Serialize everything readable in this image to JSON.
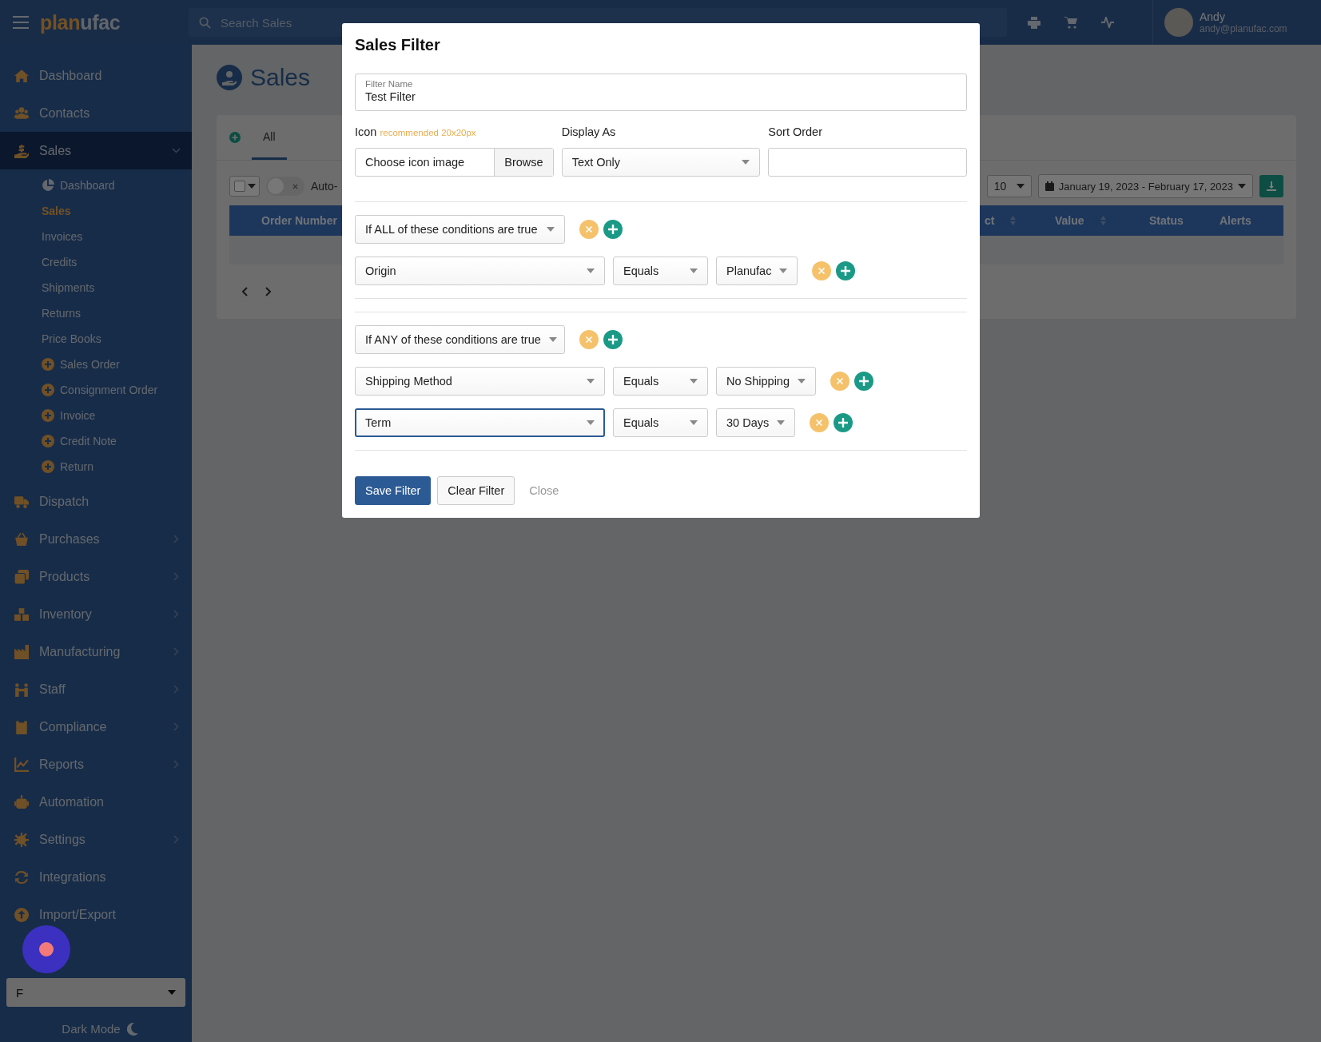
{
  "topbar": {
    "logo": {
      "accent": "plan",
      "rest": "ufac"
    },
    "search_placeholder": "Search Sales",
    "user": {
      "name": "Andy",
      "email": "andy@planufac.com"
    }
  },
  "sidebar": {
    "items": [
      {
        "label": "Dashboard",
        "selected": false
      },
      {
        "label": "Contacts",
        "selected": false
      },
      {
        "label": "Sales",
        "selected": true,
        "expanded": true,
        "children": [
          {
            "label": "Dashboard",
            "kind": "dashboard",
            "selected": false
          },
          {
            "label": "Sales",
            "kind": "link",
            "selected": true
          },
          {
            "label": "Invoices",
            "kind": "link",
            "selected": false
          },
          {
            "label": "Credits",
            "kind": "link",
            "selected": false
          },
          {
            "label": "Shipments",
            "kind": "link",
            "selected": false
          },
          {
            "label": "Returns",
            "kind": "link",
            "selected": false
          },
          {
            "label": "Price Books",
            "kind": "link",
            "selected": false
          },
          {
            "label": "Sales Order",
            "kind": "create",
            "selected": false
          },
          {
            "label": "Consignment Order",
            "kind": "create",
            "selected": false
          },
          {
            "label": "Invoice",
            "kind": "create",
            "selected": false
          },
          {
            "label": "Credit Note",
            "kind": "create",
            "selected": false
          },
          {
            "label": "Return",
            "kind": "create",
            "selected": false
          }
        ]
      },
      {
        "label": "Dispatch",
        "selected": false
      },
      {
        "label": "Purchases",
        "selected": false,
        "expanded": false
      },
      {
        "label": "Products",
        "selected": false,
        "expanded": false
      },
      {
        "label": "Inventory",
        "selected": false,
        "expanded": false
      },
      {
        "label": "Manufacturing",
        "selected": false,
        "expanded": false
      },
      {
        "label": "Staff",
        "selected": false,
        "expanded": false
      },
      {
        "label": "Compliance",
        "selected": false,
        "expanded": false
      },
      {
        "label": "Reports",
        "selected": false,
        "expanded": false
      },
      {
        "label": "Automation",
        "selected": false
      },
      {
        "label": "Settings",
        "selected": false,
        "expanded": false
      },
      {
        "label": "Integrations",
        "selected": false
      },
      {
        "label": "Import/Export",
        "selected": false
      }
    ],
    "footer_select": "F",
    "dark_mode": "Dark Mode"
  },
  "page": {
    "title": "Sales",
    "tabs": [
      {
        "label": "All",
        "selected": true
      }
    ],
    "toolbar": {
      "select_all_checked": false,
      "auto_toggle": {
        "label": "Auto-",
        "on": false
      },
      "page_size": "10",
      "date_range": "January 19, 2023 - February 17, 2023"
    },
    "table": {
      "columns": [
        {
          "label": "Order Number"
        },
        {
          "label": "ct",
          "sortable": true
        },
        {
          "label": "Value",
          "sortable": true
        },
        {
          "label": "Status"
        },
        {
          "label": "Alerts"
        }
      ]
    }
  },
  "modal": {
    "title": "Sales Filter",
    "filter_name": {
      "label": "Filter Name",
      "value": "Test Filter"
    },
    "icon": {
      "label": "Icon",
      "hint": "recommended 20x20px",
      "placeholder": "Choose icon image",
      "button": "Browse"
    },
    "display_as": {
      "label": "Display As",
      "value": "Text Only"
    },
    "sort_order": {
      "label": "Sort Order"
    },
    "groups": [
      {
        "match": "If ALL of these conditions are true",
        "conditions": [
          {
            "field": "Origin",
            "operator": "Equals",
            "value": "Planufac",
            "focused": false
          }
        ]
      },
      {
        "match": "If ANY of these conditions are true",
        "conditions": [
          {
            "field": "Shipping Method",
            "operator": "Equals",
            "value": "No Shipping",
            "focused": false
          },
          {
            "field": "Term",
            "operator": "Equals",
            "value": "30 Days",
            "focused": true
          }
        ]
      }
    ],
    "buttons": [
      {
        "label": "Save Filter",
        "kind": "primary"
      },
      {
        "label": "Clear Filter",
        "kind": "secondary"
      },
      {
        "label": "Close",
        "kind": "link"
      }
    ]
  }
}
